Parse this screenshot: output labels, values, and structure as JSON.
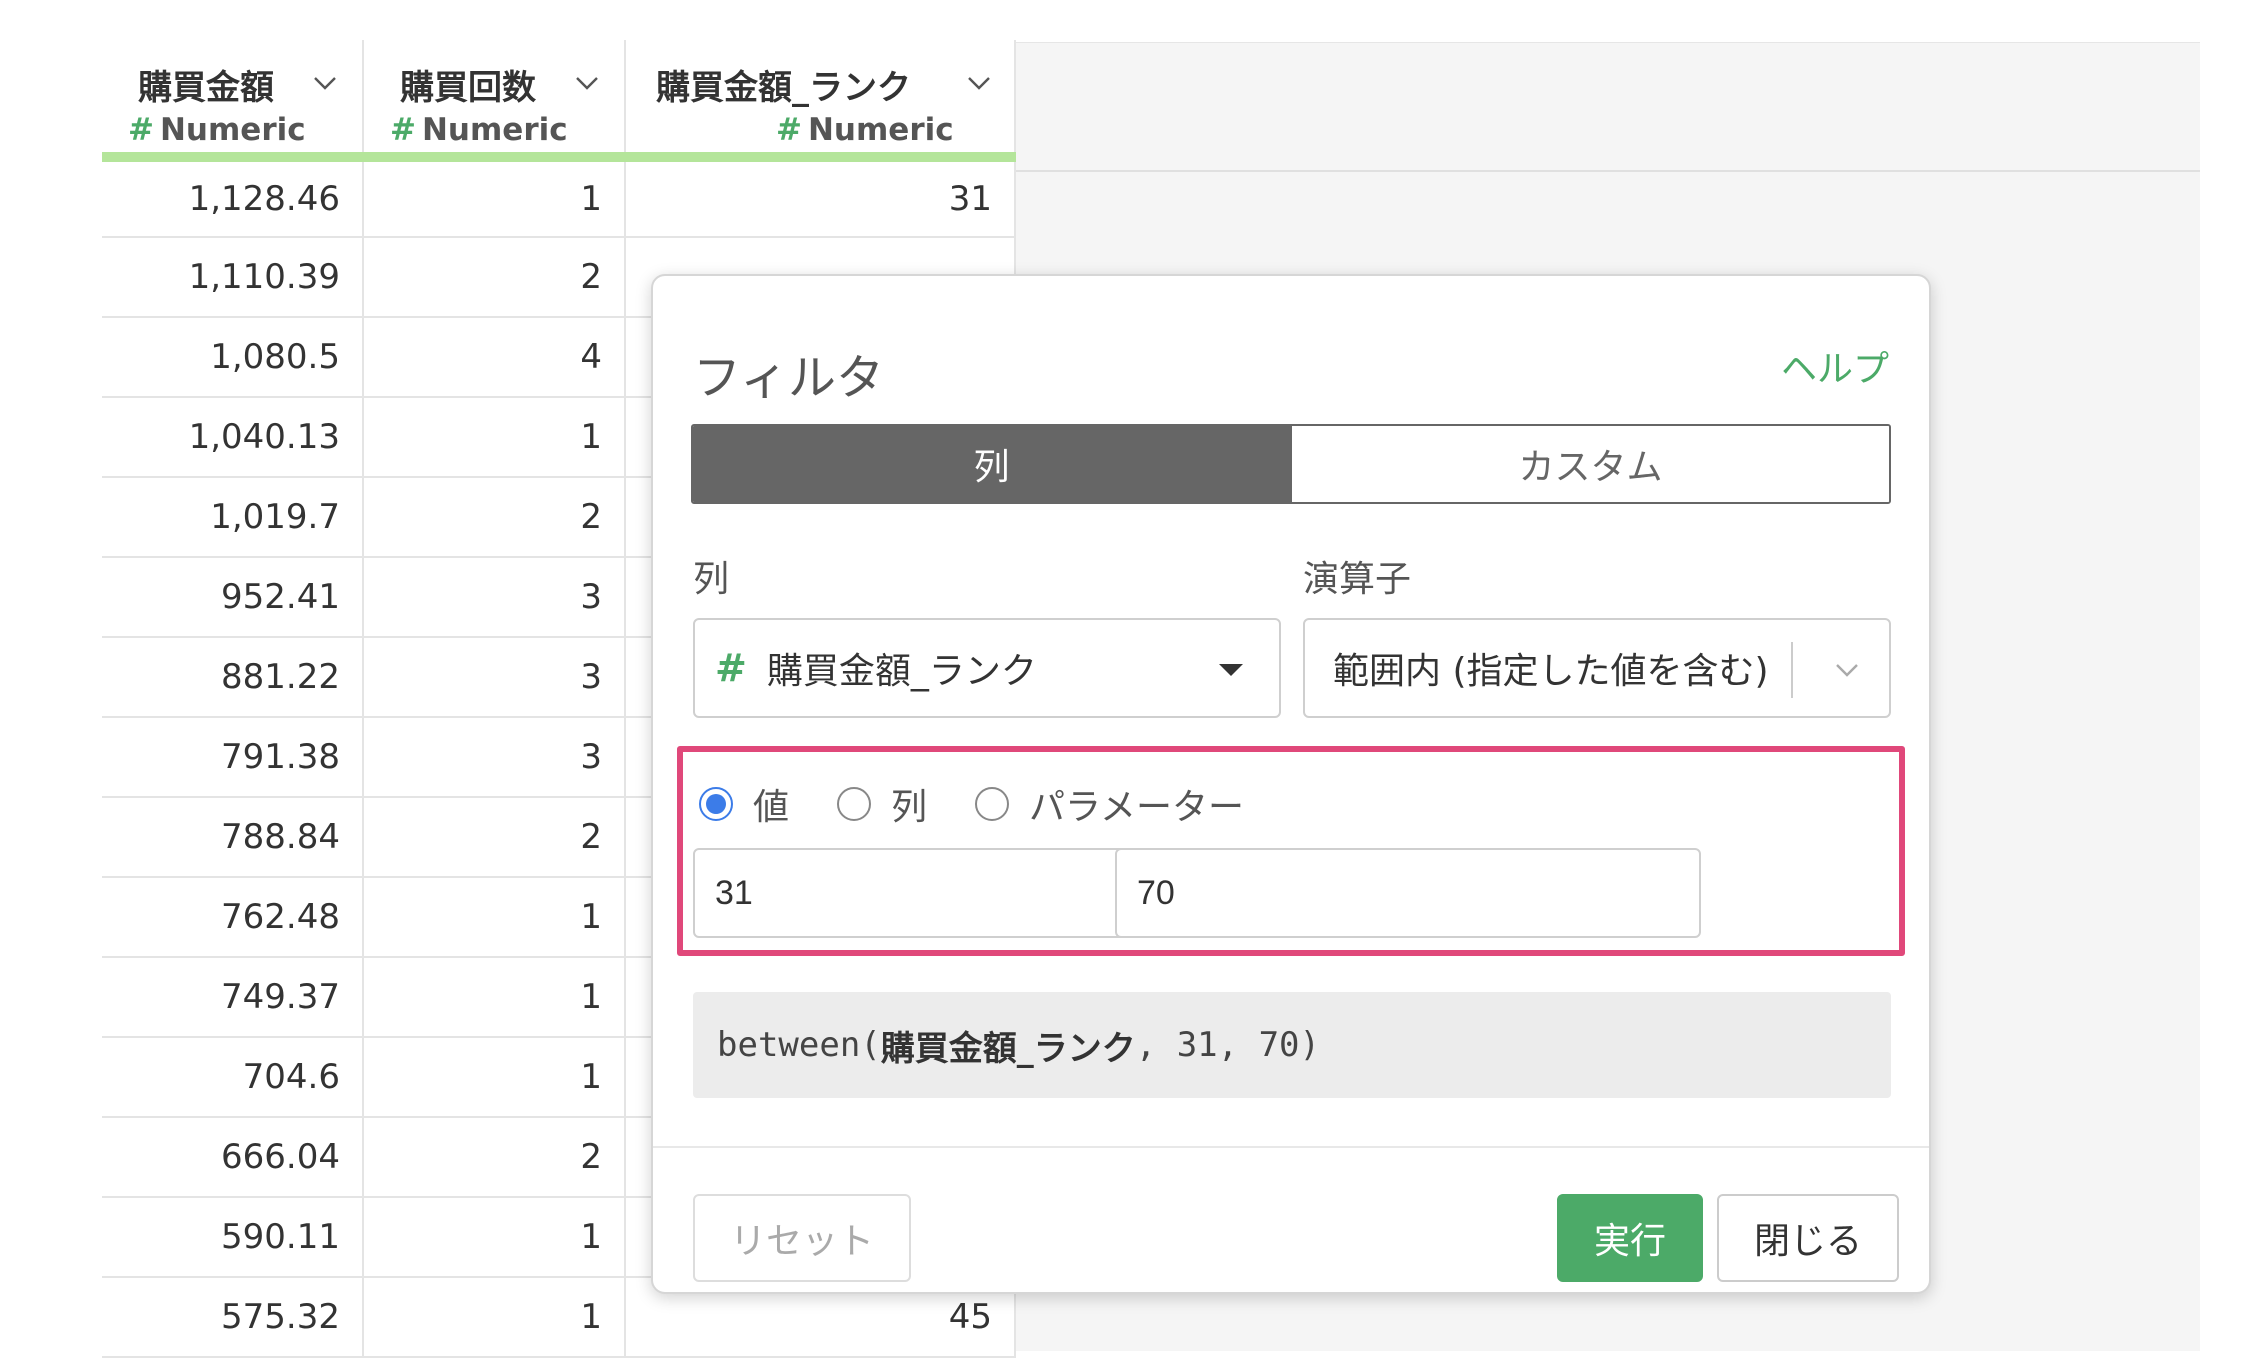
{
  "table": {
    "columns": [
      {
        "name": "購買金額",
        "type": "Numeric"
      },
      {
        "name": "購買回数",
        "type": "Numeric"
      },
      {
        "name": "購買金額_ランク",
        "type": "Numeric"
      }
    ],
    "rows": [
      [
        "1,128.46",
        "1",
        "31"
      ],
      [
        "1,110.39",
        "2",
        ""
      ],
      [
        "1,080.5",
        "4",
        ""
      ],
      [
        "1,040.13",
        "1",
        ""
      ],
      [
        "1,019.7",
        "2",
        ""
      ],
      [
        "952.41",
        "3",
        ""
      ],
      [
        "881.22",
        "3",
        ""
      ],
      [
        "791.38",
        "3",
        ""
      ],
      [
        "788.84",
        "2",
        ""
      ],
      [
        "762.48",
        "1",
        ""
      ],
      [
        "749.37",
        "1",
        ""
      ],
      [
        "704.6",
        "1",
        ""
      ],
      [
        "666.04",
        "2",
        ""
      ],
      [
        "590.11",
        "1",
        ""
      ],
      [
        "575.32",
        "1",
        "45"
      ]
    ]
  },
  "dialog": {
    "title": "フィルタ",
    "help_label": "ヘルプ",
    "tabs": [
      {
        "label": "列",
        "active": true
      },
      {
        "label": "カスタム",
        "active": false
      }
    ],
    "column_label": "列",
    "column_value": "購買金額_ランク",
    "operator_label": "演算子",
    "operator_value": "範囲内 (指定した値を含む)",
    "radio_options": [
      {
        "label": "値",
        "checked": true
      },
      {
        "label": "列",
        "checked": false
      },
      {
        "label": "パラメーター",
        "checked": false
      }
    ],
    "value_from": "31",
    "value_to": "70",
    "expression": {
      "prefix": "between(",
      "column": "購買金額_ランク",
      "suffix": ", 31, 70)"
    },
    "buttons": {
      "reset": "リセット",
      "run": "実行",
      "close": "閉じる"
    }
  },
  "colors": {
    "accent_green": "#4caa68",
    "header_underline": "#b4e59a",
    "highlight_border": "#e0487a",
    "radio_blue": "#3c7ce8"
  }
}
